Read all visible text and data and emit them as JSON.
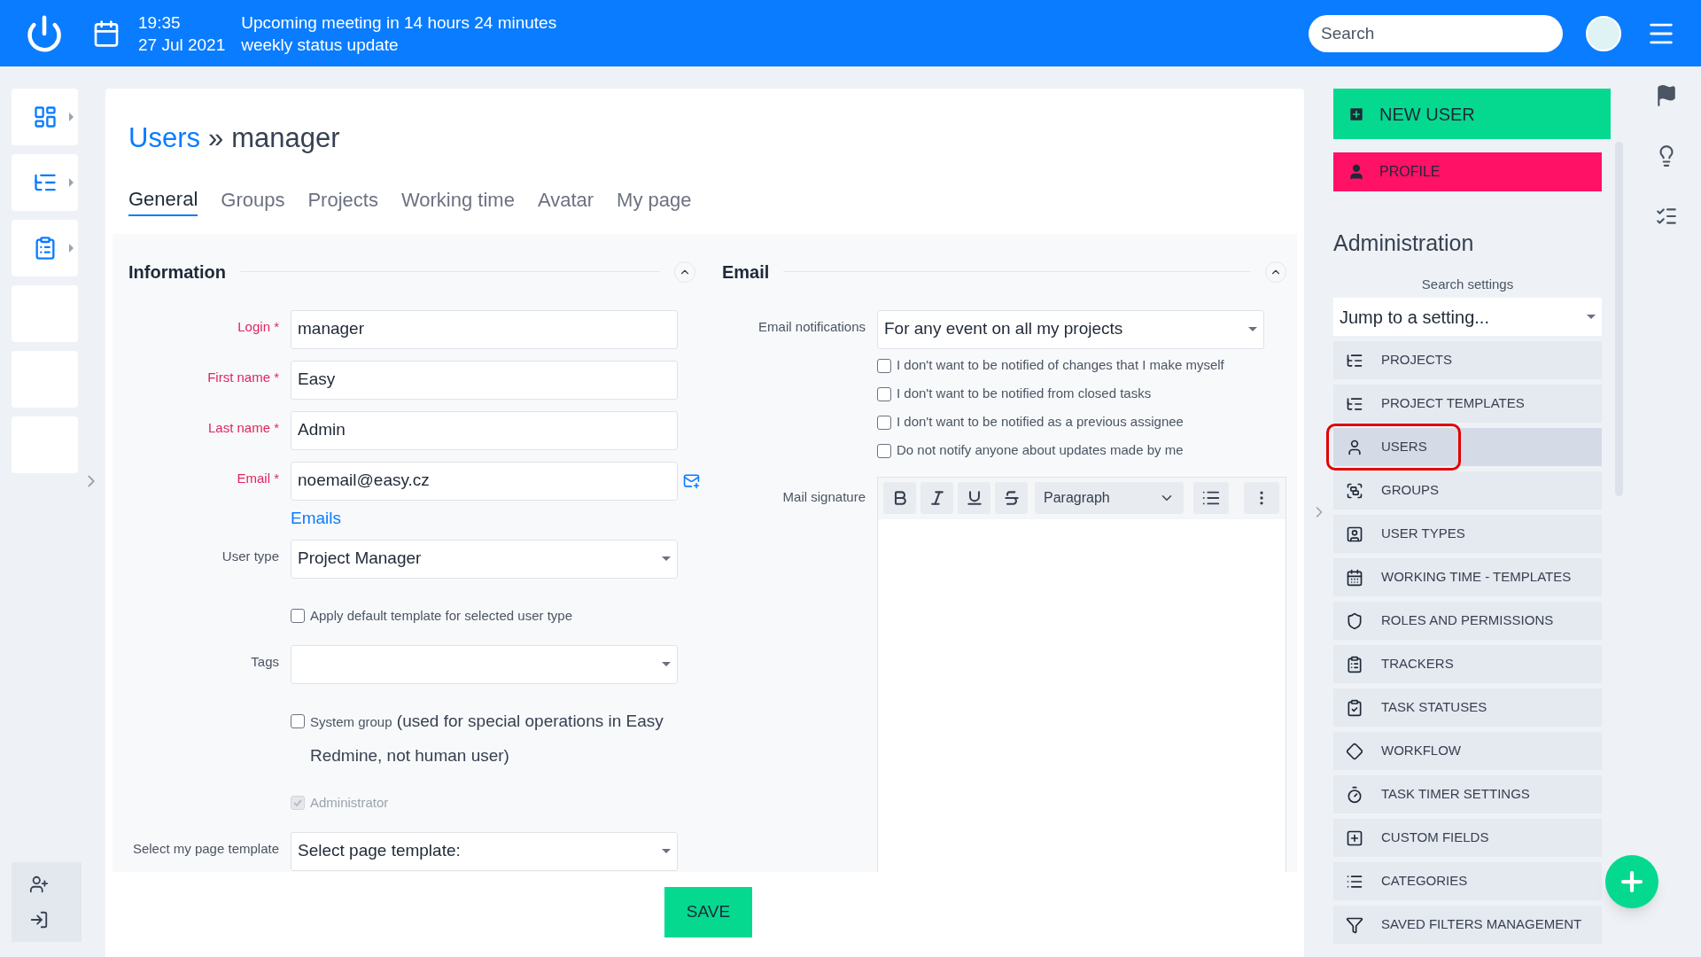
{
  "top_bar": {
    "time": "19:35",
    "meeting": "Upcoming meeting in 14 hours 24 minutes",
    "date": "27 Jul 2021",
    "meeting_title": "weekly status update",
    "search": {
      "placeholder": "Search"
    }
  },
  "breadcrumb": {
    "parent": "Users",
    "separator": "»",
    "current": "manager"
  },
  "tabs": [
    {
      "label": "General",
      "selected": true
    },
    {
      "label": "Groups",
      "selected": false
    },
    {
      "label": "Projects",
      "selected": false
    },
    {
      "label": "Working time",
      "selected": false
    },
    {
      "label": "Avatar",
      "selected": false
    },
    {
      "label": "My page",
      "selected": false
    }
  ],
  "information": {
    "title": "Information",
    "fields": [
      {
        "kind": "input",
        "label": "Login *",
        "required": true,
        "value": "manager"
      },
      {
        "kind": "input",
        "label": "First name *",
        "required": true,
        "value": "Easy"
      },
      {
        "kind": "input",
        "label": "Last name *",
        "required": true,
        "value": "Admin"
      },
      {
        "kind": "email",
        "label": "Email *",
        "required": true,
        "value": "noemail@easy.cz",
        "link": "Emails"
      },
      {
        "kind": "select",
        "label": "User type",
        "required": false,
        "value": "Project Manager"
      },
      {
        "kind": "checkbox",
        "label": "Apply default template for selected user type",
        "checked": false,
        "disabled": false
      },
      {
        "kind": "select",
        "label": "Tags",
        "required": false
      },
      {
        "kind": "checkbox",
        "label": "System group",
        "note": "(used for special operations in Easy Redmine, not human user)",
        "checked": false,
        "disabled": false
      },
      {
        "kind": "checkbox",
        "label": "Administrator",
        "checked": true,
        "disabled": true
      },
      {
        "kind": "select",
        "label": "Select my page template",
        "required": false,
        "value": "Select page template:"
      }
    ]
  },
  "email": {
    "title": "Email",
    "notifications": {
      "label": "Email notifications",
      "value": "For any event on all my projects"
    },
    "options": [
      {
        "label": "I don't want to be notified of changes that I make myself",
        "checked": false
      },
      {
        "label": "I don't want to be notified from closed tasks",
        "checked": false
      },
      {
        "label": "I don't want to be notified as a previous assignee",
        "checked": false
      },
      {
        "label": "Do not notify anyone about updates made by me",
        "checked": false
      }
    ],
    "signature": {
      "label": "Mail signature",
      "format": "Paragraph"
    }
  },
  "save_button": "SAVE",
  "sidebar": {
    "new_user": "NEW USER",
    "profile": "PROFILE",
    "title": "Administration",
    "search_label": "Search settings",
    "jump": "Jump to a setting...",
    "items": [
      {
        "label": "PROJECTS",
        "selected": false
      },
      {
        "label": "PROJECT TEMPLATES",
        "selected": false
      },
      {
        "label": "USERS",
        "selected": true
      },
      {
        "label": "GROUPS",
        "selected": false
      },
      {
        "label": "USER TYPES",
        "selected": false
      },
      {
        "label": "WORKING TIME - TEMPLATES",
        "selected": false
      },
      {
        "label": "ROLES AND PERMISSIONS",
        "selected": false
      },
      {
        "label": "TRACKERS",
        "selected": false
      },
      {
        "label": "TASK STATUSES",
        "selected": false
      },
      {
        "label": "WORKFLOW",
        "selected": false
      },
      {
        "label": "TASK TIMER SETTINGS",
        "selected": false
      },
      {
        "label": "CUSTOM FIELDS",
        "selected": false
      },
      {
        "label": "CATEGORIES",
        "selected": false
      },
      {
        "label": "SAVED FILTERS MANAGEMENT",
        "selected": false
      }
    ]
  }
}
